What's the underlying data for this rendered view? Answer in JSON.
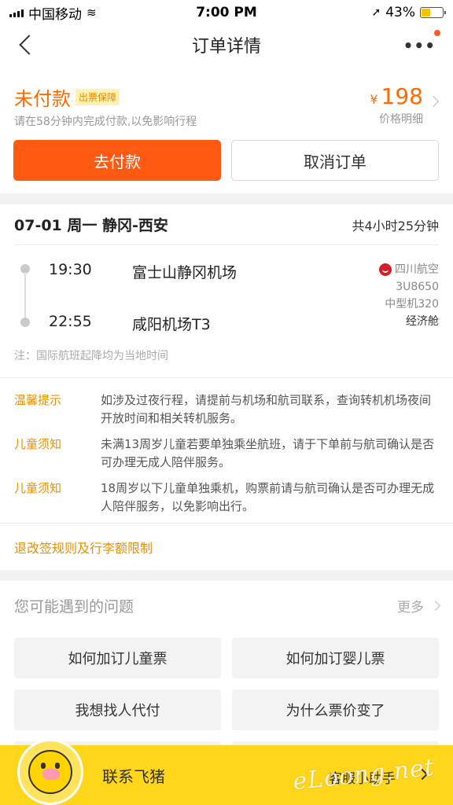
{
  "status_bar": {
    "carrier": "中国移动",
    "time": "7:00 PM",
    "battery": "43%",
    "battery_level": 0.43
  },
  "nav": {
    "title": "订单详情",
    "more": "•••"
  },
  "payment": {
    "status": "未付款",
    "tag": "出票保障",
    "tip": "请在58分钟内完成付款,以免影响行程",
    "currency": "¥",
    "price": "198",
    "price_detail": "价格明细",
    "pay_button": "去付款",
    "cancel_button": "取消订单"
  },
  "flight": {
    "route": "07-01 周一 静冈-西安",
    "duration": "共4小时25分钟",
    "segments": [
      {
        "time": "19:30",
        "airport": "富士山静冈机场"
      },
      {
        "time": "22:55",
        "airport": "咸阳机场T3"
      }
    ],
    "airline": "四川航空",
    "flight_no": "3U8650",
    "aircraft": "中型机320",
    "cabin": "经济舱",
    "note": "注：国际航班起降均为当地时间"
  },
  "tips": [
    {
      "label": "温馨提示",
      "text": "如涉及过夜行程，请提前与机场和航司联系，查询转机机场夜间开放时间和相关转机服务。"
    },
    {
      "label": "儿童须知",
      "text": "未满13周岁儿童若要单独乘坐航班，请于下单前与航司确认是否可办理无成人陪伴服务。"
    },
    {
      "label": "儿童须知",
      "text": "18周岁以下儿童单独乘机，购票前请与航司确认是否可办理无成人陪伴服务，以免影响出行。"
    }
  ],
  "rules_link": "退改签规则及行李额限制",
  "faq": {
    "title": "您可能遇到的问题",
    "more": "更多",
    "items": [
      "如何加订儿童票",
      "如何加订婴儿票",
      "我想找人代付",
      "为什么票价变了"
    ]
  },
  "bottom": {
    "contact": "联系飞猪",
    "assistant": "客服小助手",
    "watermark": "eLoong.net"
  },
  "colors": {
    "accent": "#ff5a12",
    "warning": "#e49200",
    "bottom_bar": "#ffd61a"
  }
}
